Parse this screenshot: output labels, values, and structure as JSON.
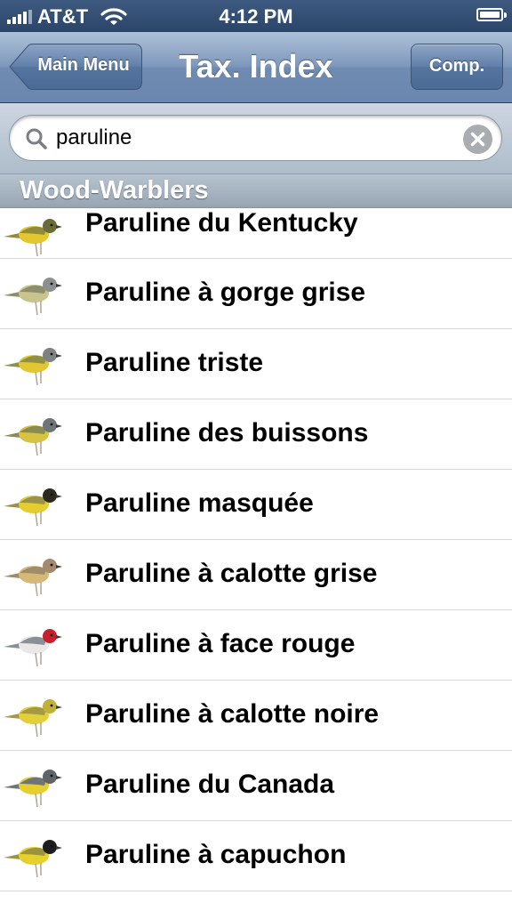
{
  "status_bar": {
    "carrier": "AT&T",
    "time": "4:12 PM"
  },
  "nav": {
    "back_label": "Main Menu",
    "title": "Tax. Index",
    "right_label": "Comp."
  },
  "search": {
    "value": "paruline"
  },
  "section": {
    "title": "Wood-Warblers"
  },
  "birds": [
    {
      "name": "Paruline du Kentucky",
      "colors": {
        "head": "#6b6b3a",
        "body": "#e3c72c",
        "back": "#8f8a3c"
      }
    },
    {
      "name": "Paruline à gorge grise",
      "colors": {
        "head": "#8a8f90",
        "body": "#c9c48e",
        "back": "#8c8e6e"
      }
    },
    {
      "name": "Paruline triste",
      "colors": {
        "head": "#7d8283",
        "body": "#e2c730",
        "back": "#8e8f48"
      }
    },
    {
      "name": "Paruline des buissons",
      "colors": {
        "head": "#6f7577",
        "body": "#d8c243",
        "back": "#8a8a55"
      }
    },
    {
      "name": "Paruline masquée",
      "colors": {
        "head": "#2a2a20",
        "body": "#e6cd2e",
        "back": "#9b924a"
      }
    },
    {
      "name": "Paruline à calotte grise",
      "colors": {
        "head": "#a38a6e",
        "body": "#d8b878",
        "back": "#9f8c6a"
      }
    },
    {
      "name": "Paruline à face rouge",
      "colors": {
        "head": "#c8202a",
        "body": "#e8e8e8",
        "back": "#8b8f96"
      }
    },
    {
      "name": "Paruline à calotte noire",
      "colors": {
        "head": "#bfb13b",
        "body": "#e3cf3a",
        "back": "#a49a43"
      }
    },
    {
      "name": "Paruline du Canada",
      "colors": {
        "head": "#5f6468",
        "body": "#e6ce2e",
        "back": "#6f7479"
      }
    },
    {
      "name": "Paruline à capuchon",
      "colors": {
        "head": "#1e1e1e",
        "body": "#e8d02c",
        "back": "#9a9440"
      }
    }
  ]
}
